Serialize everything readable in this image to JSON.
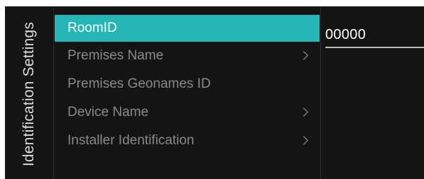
{
  "panel": {
    "title": "Identification Settings"
  },
  "menu": {
    "items": [
      {
        "label": "RoomID",
        "selected": true,
        "has_submenu": false
      },
      {
        "label": "Premises Name",
        "selected": false,
        "has_submenu": true
      },
      {
        "label": "Premises Geonames ID",
        "selected": false,
        "has_submenu": false
      },
      {
        "label": "Device Name",
        "selected": false,
        "has_submenu": true
      },
      {
        "label": "Installer Identification",
        "selected": false,
        "has_submenu": true
      }
    ]
  },
  "value_field": {
    "value": "00000"
  },
  "colors": {
    "background": "#141414",
    "accent": "#27b6b6",
    "text_dim": "#8a8a8a",
    "text_bright": "#ffffff"
  },
  "icons": {
    "submenu": "chevron-right-icon"
  }
}
